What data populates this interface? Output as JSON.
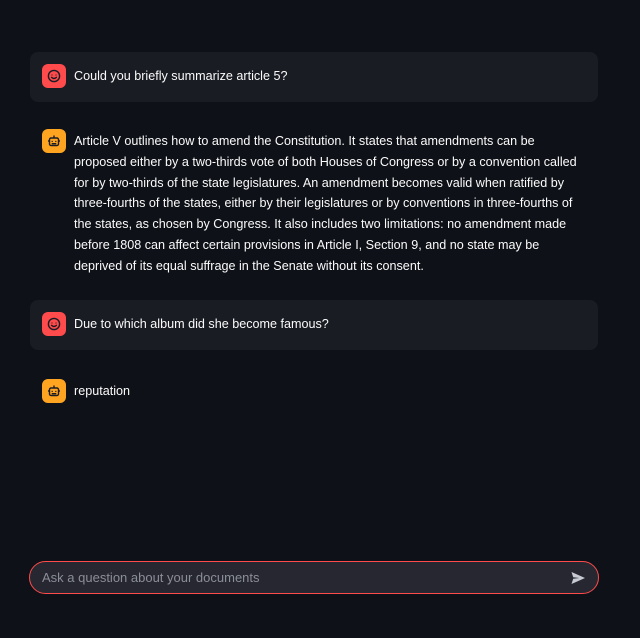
{
  "messages": [
    {
      "role": "user",
      "text": "Could you briefly summarize article 5?"
    },
    {
      "role": "assistant",
      "text": "Article V outlines how to amend the Constitution. It states that amendments can be proposed either by a two-thirds vote of both Houses of Congress or by a convention called for by two-thirds of the state legislatures. An amendment becomes valid when ratified by three-fourths of the states, either by their legislatures or by conventions in three-fourths of the states, as chosen by Congress. It also includes two limitations: no amendment made before 1808 can affect certain provisions in Article I, Section 9, and no state may be deprived of its equal suffrage in the Senate without its consent."
    },
    {
      "role": "user",
      "text": "Due to which album did she become famous?"
    },
    {
      "role": "assistant",
      "text": "reputation"
    }
  ],
  "chat_input": {
    "placeholder": "Ask a question about your documents",
    "value": ""
  },
  "icons": {
    "user_avatar": "smiley-face-icon",
    "assistant_avatar": "robot-icon",
    "send": "send-icon"
  },
  "colors": {
    "background": "#0e1117",
    "user_message_bg": "#1a1c24",
    "user_avatar": "#ff4b4b",
    "assistant_avatar": "#ffa421",
    "input_border": "#ff4b4b",
    "input_bg": "#262730"
  }
}
